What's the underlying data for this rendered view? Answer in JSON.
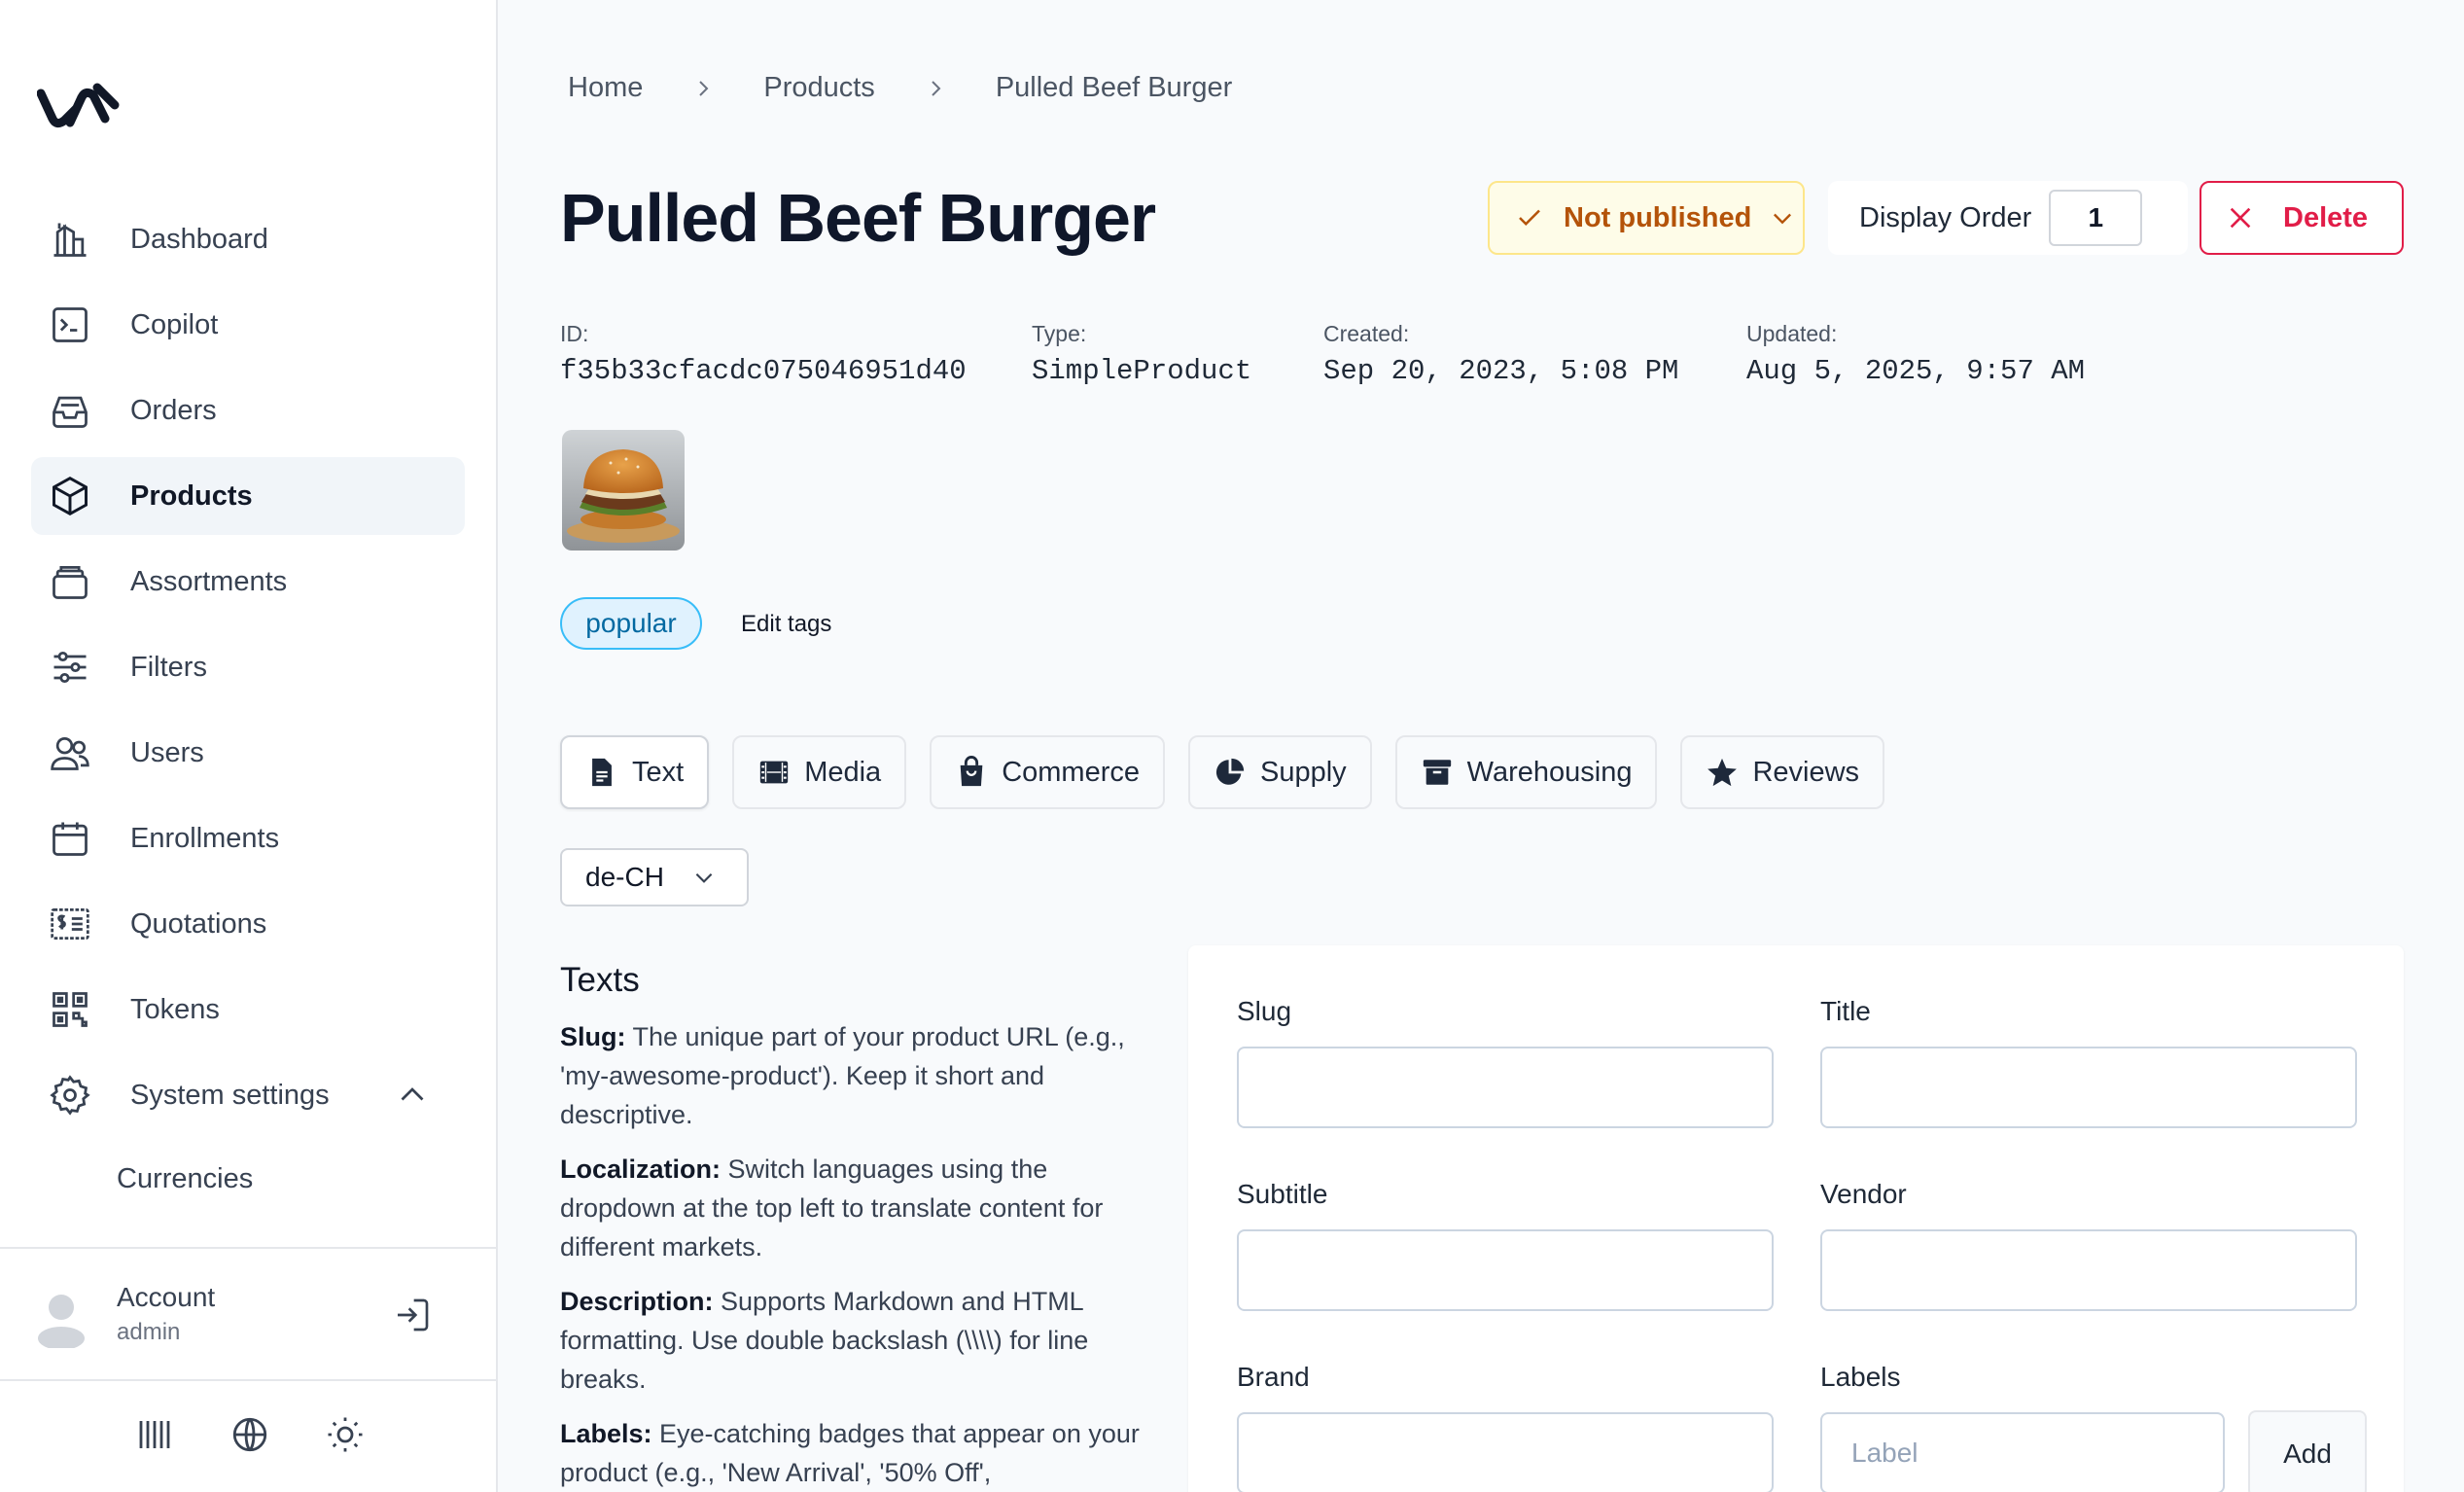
{
  "sidebar": {
    "nav": [
      {
        "label": "Dashboard",
        "icon": "chart-building-icon"
      },
      {
        "label": "Copilot",
        "icon": "terminal-icon"
      },
      {
        "label": "Orders",
        "icon": "inbox-icon"
      },
      {
        "label": "Products",
        "icon": "cube-icon",
        "active": true
      },
      {
        "label": "Assortments",
        "icon": "stack-icon"
      },
      {
        "label": "Filters",
        "icon": "sliders-icon"
      },
      {
        "label": "Users",
        "icon": "users-icon"
      },
      {
        "label": "Enrollments",
        "icon": "calendar-icon"
      },
      {
        "label": "Quotations",
        "icon": "receipt-icon"
      },
      {
        "label": "Tokens",
        "icon": "qr-code-icon"
      },
      {
        "label": "System settings",
        "icon": "gear-icon"
      }
    ],
    "sub_items": [
      "Currencies"
    ],
    "account": {
      "name": "Account",
      "role": "admin"
    }
  },
  "breadcrumb": [
    "Home",
    "Products",
    "Pulled Beef Burger"
  ],
  "product": {
    "title": "Pulled Beef Burger",
    "status": "Not published",
    "display_order_label": "Display Order",
    "display_order": "1",
    "delete_label": "Delete",
    "meta": [
      {
        "label": "ID:",
        "value": "f35b33cfacdc075046951d40"
      },
      {
        "label": "Type:",
        "value": "SimpleProduct"
      },
      {
        "label": "Created:",
        "value": "Sep 20, 2023, 5:08 PM"
      },
      {
        "label": "Updated:",
        "value": "Aug 5, 2025, 9:57 AM"
      }
    ],
    "tag": "popular",
    "edit_tags_label": "Edit tags"
  },
  "tabs": [
    {
      "label": "Text",
      "active": true
    },
    {
      "label": "Media"
    },
    {
      "label": "Commerce"
    },
    {
      "label": "Supply"
    },
    {
      "label": "Warehousing"
    },
    {
      "label": "Reviews"
    }
  ],
  "locale": "de-CH",
  "help": {
    "title": "Texts",
    "items": [
      {
        "term": "Slug:",
        "text": " The unique part of your product URL (e.g., 'my-awesome-product'). Keep it short and descriptive."
      },
      {
        "term": "Localization:",
        "text": " Switch languages using the dropdown at the top left to translate content for different markets."
      },
      {
        "term": "Description:",
        "text": " Supports Markdown and HTML formatting. Use double backslash (\\\\\\\\) for line breaks."
      },
      {
        "term": "Labels:",
        "text": " Eye-catching badges that appear on your product (e.g., 'New Arrival', '50% Off',"
      }
    ]
  },
  "form": {
    "slug_label": "Slug",
    "title_label": "Title",
    "subtitle_label": "Subtitle",
    "vendor_label": "Vendor",
    "brand_label": "Brand",
    "labels_label": "Labels",
    "label_placeholder": "Label",
    "add_label": "Add"
  },
  "colors": {
    "accent_danger": "#e11d48",
    "status_warning": "#b45309",
    "tag_blue": "#0369a1"
  }
}
